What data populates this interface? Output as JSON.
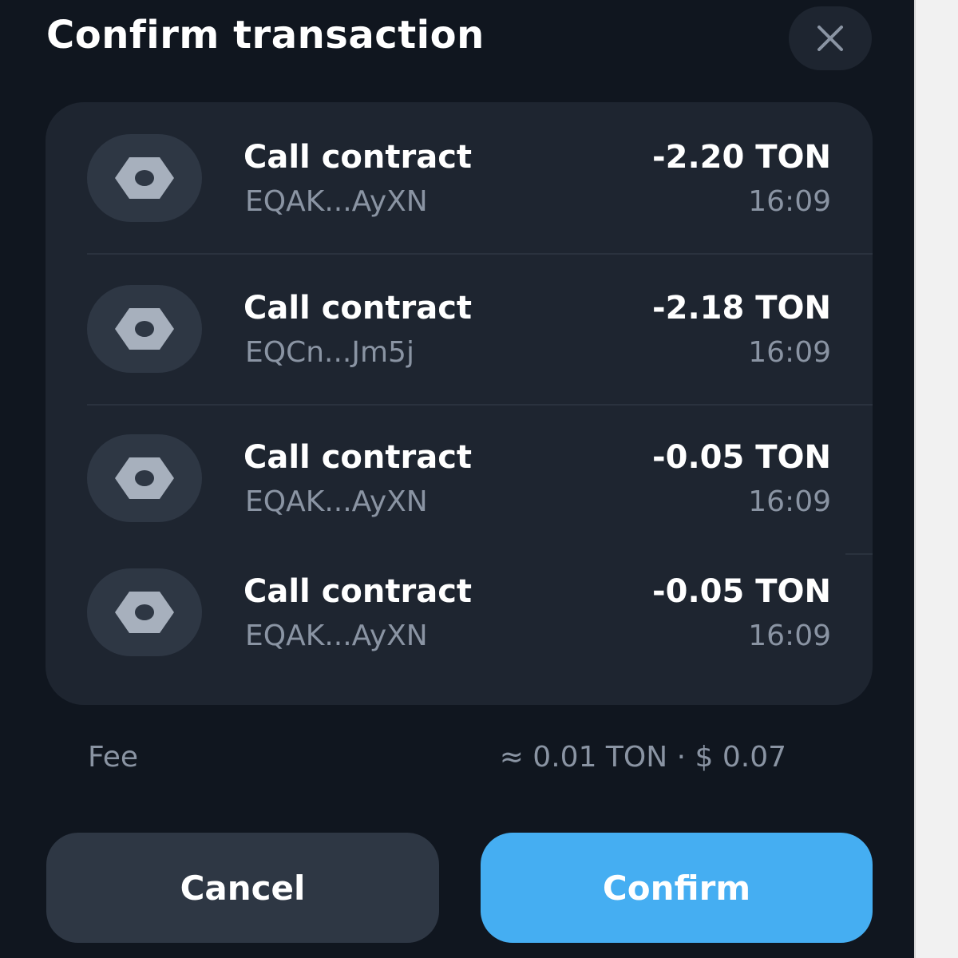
{
  "header": {
    "title": "Confirm transaction",
    "close_icon": "close-icon"
  },
  "transactions": [
    {
      "icon": "nut-icon",
      "name": "Call contract",
      "address": "EQAK...AyXN",
      "amount": "-2.20 TON",
      "time": "16:09"
    },
    {
      "icon": "nut-icon",
      "name": "Call contract",
      "address": "EQCn...Jm5j",
      "amount": "-2.18 TON",
      "time": "16:09"
    },
    {
      "icon": "nut-icon",
      "name": "Call contract",
      "address": "EQAK...AyXN",
      "amount": "-0.05 TON",
      "time": "16:09"
    },
    {
      "icon": "nut-icon",
      "name": "Call contract",
      "address": "EQAK...AyXN",
      "amount": "-0.05 TON",
      "time": "16:09"
    }
  ],
  "fee": {
    "label": "Fee",
    "value": "≈ 0.01 TON · $ 0.07"
  },
  "actions": {
    "cancel_label": "Cancel",
    "confirm_label": "Confirm"
  },
  "colors": {
    "background": "#10161f",
    "card": "#1e2530",
    "accent": "#45aef2",
    "secondary_text": "#8a94a3"
  }
}
